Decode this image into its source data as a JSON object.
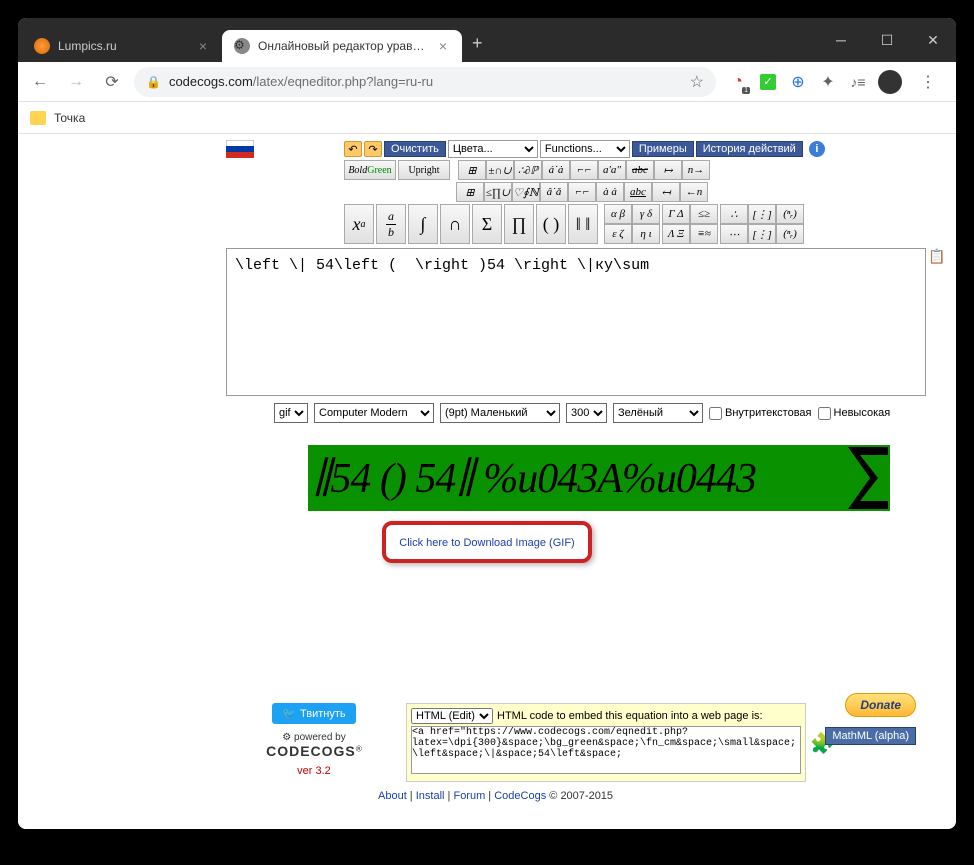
{
  "window": {
    "tabs": [
      {
        "title": "Lumpics.ru",
        "active": false
      },
      {
        "title": "Онлайновый редактор уравнен",
        "active": true
      }
    ],
    "url_domain": "codecogs.com",
    "url_path": "/latex/eqneditor.php?lang=ru-ru"
  },
  "bookmarks": {
    "item0": "Точка"
  },
  "toolbar": {
    "clear": "Очистить",
    "colors": "Цвета...",
    "functions": "Functions...",
    "examples": "Примеры",
    "history": "История действий",
    "bold": "Bold",
    "green": "Green",
    "upright": "Upright"
  },
  "editor": {
    "latex": "\\left \\| 54\\left (  \\right )54 \\right \\|ку\\sum"
  },
  "options": {
    "format": "gif",
    "font": "Computer Modern",
    "size": "(9pt) Маленький",
    "dpi": "300",
    "color": "Зелёный",
    "inline_label": "Внутритекстовая",
    "compressed_label": "Невысокая"
  },
  "preview": {
    "text": "∥54 () 54∥ %u043A%u0443"
  },
  "download": {
    "link_text": "Click here to Download Image (GIF)"
  },
  "footer": {
    "tweet": "Твитнуть",
    "powered_by": "powered by",
    "codecogs": "CODECOGS",
    "version": "ver 3.2",
    "embed_format": "HTML (Edit)",
    "embed_desc": "HTML code to embed this equation into a web page is:",
    "embed_code": "<a href=\"https://www.codecogs.com/eqnedit.php?latex=\\dpi{300}&space;\\bg_green&space;\\fn_cm&space;\\small&space;\\left&space;\\|&space;54\\left&space;",
    "donate": "Donate",
    "mathml": "MathML (alpha)",
    "links": {
      "about": "About",
      "install": "Install",
      "forum": "Forum",
      "codecogs": "CodeCogs",
      "copyright": "© 2007-2015"
    }
  }
}
